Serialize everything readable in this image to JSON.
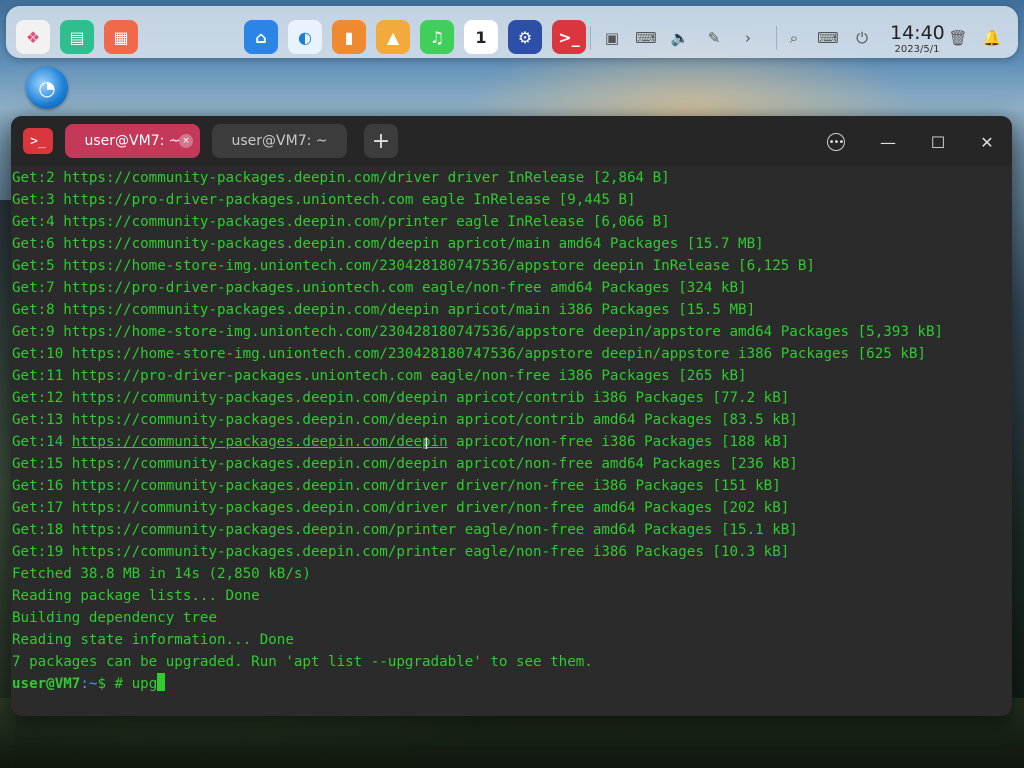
{
  "dock": {
    "apps": [
      {
        "name": "launcher-icon",
        "glyph": "❖",
        "bg": "#f2f2f2",
        "fg": "#e0507a"
      },
      {
        "name": "multitask-view-icon",
        "glyph": "▤",
        "bg": "#2fbf8f",
        "fg": "#ffffff"
      },
      {
        "name": "workspace-icon",
        "glyph": "▦",
        "bg": "#f06a4a",
        "fg": "#ffffff"
      },
      {
        "name": "file-manager-icon",
        "glyph": "⌂",
        "bg": "#2b84e6",
        "fg": "#ffffff"
      },
      {
        "name": "browser-icon",
        "glyph": "◐",
        "bg": "#e9f3ff",
        "fg": "#1b7fd6"
      },
      {
        "name": "app-store-icon",
        "glyph": "▮",
        "bg": "#f08a30",
        "fg": "#ffffff"
      },
      {
        "name": "image-viewer-icon",
        "glyph": "▲",
        "bg": "#f3a93b",
        "fg": "#ffffff"
      },
      {
        "name": "music-icon",
        "glyph": "♫",
        "bg": "#3fcf5a",
        "fg": "#ffffff"
      },
      {
        "name": "calendar-icon",
        "glyph": "1",
        "bg": "#ffffff",
        "fg": "#222222"
      },
      {
        "name": "settings-icon",
        "glyph": "⚙",
        "bg": "#2e4fa8",
        "fg": "#ffffff"
      },
      {
        "name": "terminal-icon",
        "glyph": ">_",
        "bg": "#d9363e",
        "fg": "#ffffff"
      }
    ],
    "tray": [
      {
        "name": "screenshot-icon",
        "glyph": "▣"
      },
      {
        "name": "keyboard-icon",
        "glyph": "⌨"
      },
      {
        "name": "volume-muted-icon",
        "glyph": "🔈"
      },
      {
        "name": "pen-icon",
        "glyph": "✎"
      },
      {
        "name": "expand-tray-icon",
        "glyph": "›"
      },
      {
        "name": "search-icon",
        "glyph": "⌕"
      },
      {
        "name": "input-method-icon",
        "glyph": "⌨"
      },
      {
        "name": "power-icon",
        "glyph": "⏻"
      }
    ],
    "clock_time": "14:40",
    "clock_date": "2023/5/1",
    "trash_glyph": "🗑",
    "notification_glyph": "🔔"
  },
  "desktop": {
    "deepin_icon_glyph": "◔"
  },
  "terminal": {
    "logo_glyph": ">_",
    "tabs": [
      {
        "label": "user@VM7: ~",
        "active": true
      },
      {
        "label": "user@VM7: ~",
        "active": false
      }
    ],
    "add_tab_glyph": "+",
    "tab_close_glyph": "×",
    "menu_glyph": "•••",
    "minimize_glyph": "—",
    "maximize_glyph": "☐",
    "close_glyph": "✕",
    "lines": [
      "Get:2 https://community-packages.deepin.com/driver driver InRelease [2,864 B]",
      "Get:3 https://pro-driver-packages.uniontech.com eagle InRelease [9,445 B]",
      "Get:4 https://community-packages.deepin.com/printer eagle InRelease [6,066 B]",
      "Get:6 https://community-packages.deepin.com/deepin apricot/main amd64 Packages [15.7 MB]",
      "Get:5 https://home-store-img.uniontech.com/230428180747536/appstore deepin InRelease [6,125 B]",
      "Get:7 https://pro-driver-packages.uniontech.com eagle/non-free amd64 Packages [324 kB]",
      "Get:8 https://community-packages.deepin.com/deepin apricot/main i386 Packages [15.5 MB]",
      "Get:9 https://home-store-img.uniontech.com/230428180747536/appstore deepin/appstore amd64 Packages [5,393 kB]",
      "Get:10 https://home-store-img.uniontech.com/230428180747536/appstore deepin/appstore i386 Packages [625 kB]",
      "Get:11 https://pro-driver-packages.uniontech.com eagle/non-free i386 Packages [265 kB]",
      "Get:12 https://community-packages.deepin.com/deepin apricot/contrib i386 Packages [77.2 kB]",
      "Get:13 https://community-packages.deepin.com/deepin apricot/contrib amd64 Packages [83.5 kB]",
      "Get:14 ",
      "Get:15 https://community-packages.deepin.com/deepin apricot/non-free amd64 Packages [236 kB]",
      "Get:16 https://community-packages.deepin.com/driver driver/non-free i386 Packages [151 kB]",
      "Get:17 https://community-packages.deepin.com/driver driver/non-free amd64 Packages [202 kB]",
      "Get:18 https://community-packages.deepin.com/printer eagle/non-free amd64 Packages [15.1 kB]",
      "Get:19 https://community-packages.deepin.com/printer eagle/non-free i386 Packages [10.3 kB]",
      "Fetched 38.8 MB in 14s (2,850 kB/s)",
      "Reading package lists... Done",
      "Building dependency tree",
      "Reading state information... Done",
      "7 packages can be upgraded. Run 'apt list --upgradable' to see them."
    ],
    "hovered_link": "https://community-packages.deepin.com/deepin",
    "hovered_line_rest": " apricot/non-free i386 Packages [188 kB]",
    "prompt_user": "user@VM7",
    "prompt_path": ":~",
    "prompt_symbol": "$ # ",
    "command_input": "upg"
  }
}
